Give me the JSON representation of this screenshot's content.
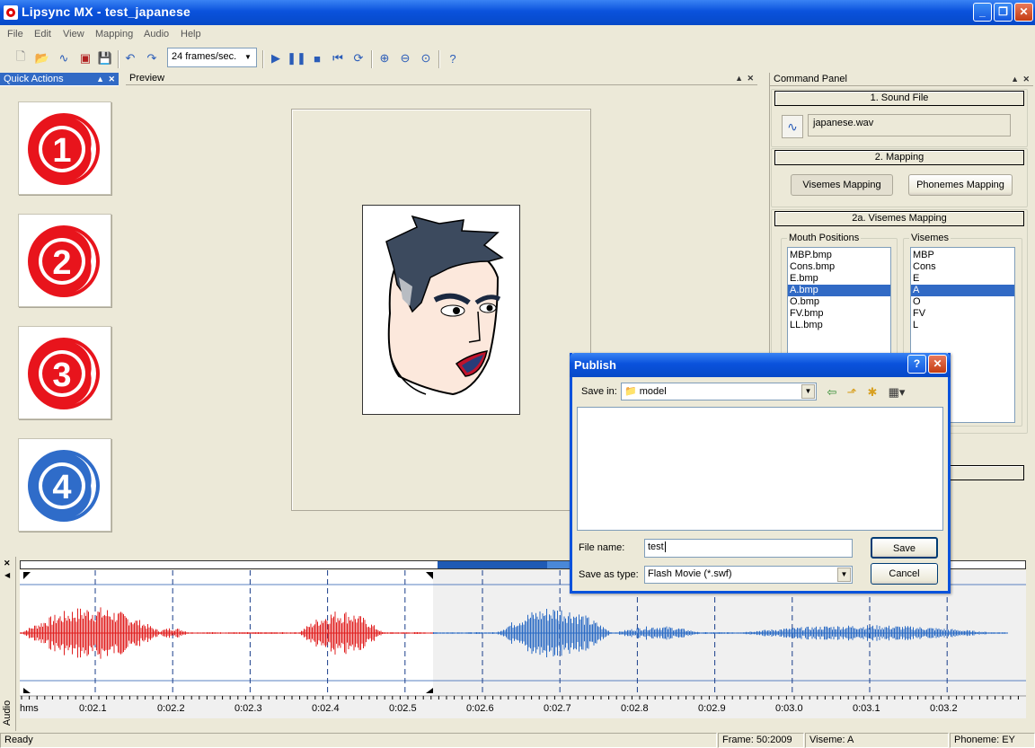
{
  "window": {
    "title": "Lipsync MX - test_japanese"
  },
  "menu": [
    "File",
    "Edit",
    "View",
    "Mapping",
    "Audio",
    "Help"
  ],
  "toolbar": {
    "fps_value": "24 frames/sec."
  },
  "quick_actions": {
    "title": "Quick Actions",
    "items": [
      "1",
      "2",
      "3",
      "4"
    ]
  },
  "preview": {
    "title": "Preview"
  },
  "command_panel": {
    "title": "Command Panel",
    "sound_file": {
      "header": "1. Sound File",
      "file": "japanese.wav"
    },
    "mapping": {
      "header": "2. Mapping",
      "visemes_btn": "Visemes Mapping",
      "phonemes_btn": "Phonemes Mapping"
    },
    "visemes_mapping": {
      "header": "2a. Visemes Mapping",
      "mouth_positions_label": "Mouth Positions",
      "visemes_label": "Visemes",
      "mouth_positions": [
        "MBP.bmp",
        "Cons.bmp",
        "E.bmp",
        "A.bmp",
        "O.bmp",
        "FV.bmp",
        "LL.bmp"
      ],
      "visemes": [
        "MBP",
        "Cons",
        "E",
        "A",
        "O",
        "FV",
        "L"
      ],
      "selected": "A"
    }
  },
  "publish_dialog": {
    "title": "Publish",
    "save_in_label": "Save in:",
    "save_in_value": "model",
    "file_name_label": "File name:",
    "file_name_value": "test",
    "save_as_type_label": "Save as type:",
    "save_as_type_value": "Flash Movie (*.swf)",
    "save_btn": "Save",
    "cancel_btn": "Cancel"
  },
  "audio": {
    "panel_label": "Audio",
    "time_labels": [
      "hms",
      "0:02.1",
      "0:02.2",
      "0:02.3",
      "0:02.4",
      "0:02.5",
      "0:02.6",
      "0:02.7",
      "0:02.8",
      "0:02.9",
      "0:03.0",
      "0:03.1",
      "0:03.2"
    ],
    "played_color": "#e02020",
    "unplayed_color": "#2a6ac4"
  },
  "status": {
    "ready": "Ready",
    "frame": "Frame: 50:2009",
    "viseme": "Viseme: A",
    "phoneme": "Phoneme: EY"
  }
}
